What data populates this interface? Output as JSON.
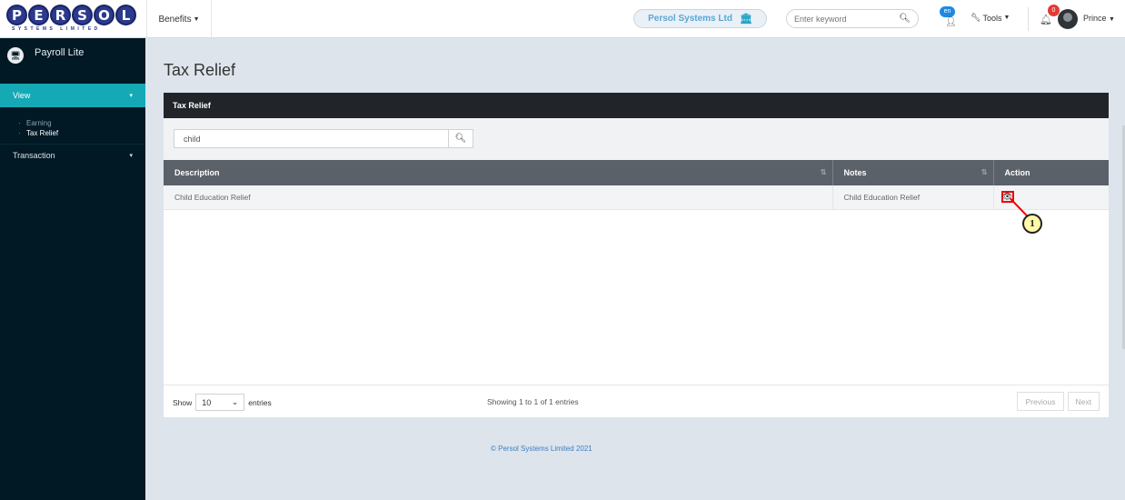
{
  "header": {
    "logo_text": "PERSOL",
    "logo_subtext": "SYSTEMS LIMITED",
    "menu_label": "Benefits",
    "company_name": "Persol Systems Ltd",
    "search_placeholder": "Enter keyword",
    "language_code": "en",
    "tools_label": "Tools",
    "notification_count": "0",
    "user_name": "Prince"
  },
  "sidebar": {
    "app_name": "Payroll Lite",
    "sections": [
      {
        "label": "View",
        "items": [
          {
            "label": "Earning"
          },
          {
            "label": "Tax Relief"
          }
        ]
      },
      {
        "label": "Transaction"
      }
    ]
  },
  "main": {
    "page_title": "Tax Relief",
    "card_title": "Tax Relief",
    "filter_value": "child",
    "table": {
      "columns": [
        "Description",
        "Notes",
        "Action"
      ],
      "rows": [
        {
          "description": "Child Education Relief",
          "notes": "Child Education Relief"
        }
      ]
    },
    "show_label": "Show",
    "page_size": "10",
    "entries_label": "entries",
    "info": "Showing 1 to 1 of 1 entries",
    "prev_label": "Previous",
    "next_label": "Next"
  },
  "annotation": {
    "number": "1"
  },
  "footer": {
    "copyright": "© Persol Systems Limited 2021"
  }
}
